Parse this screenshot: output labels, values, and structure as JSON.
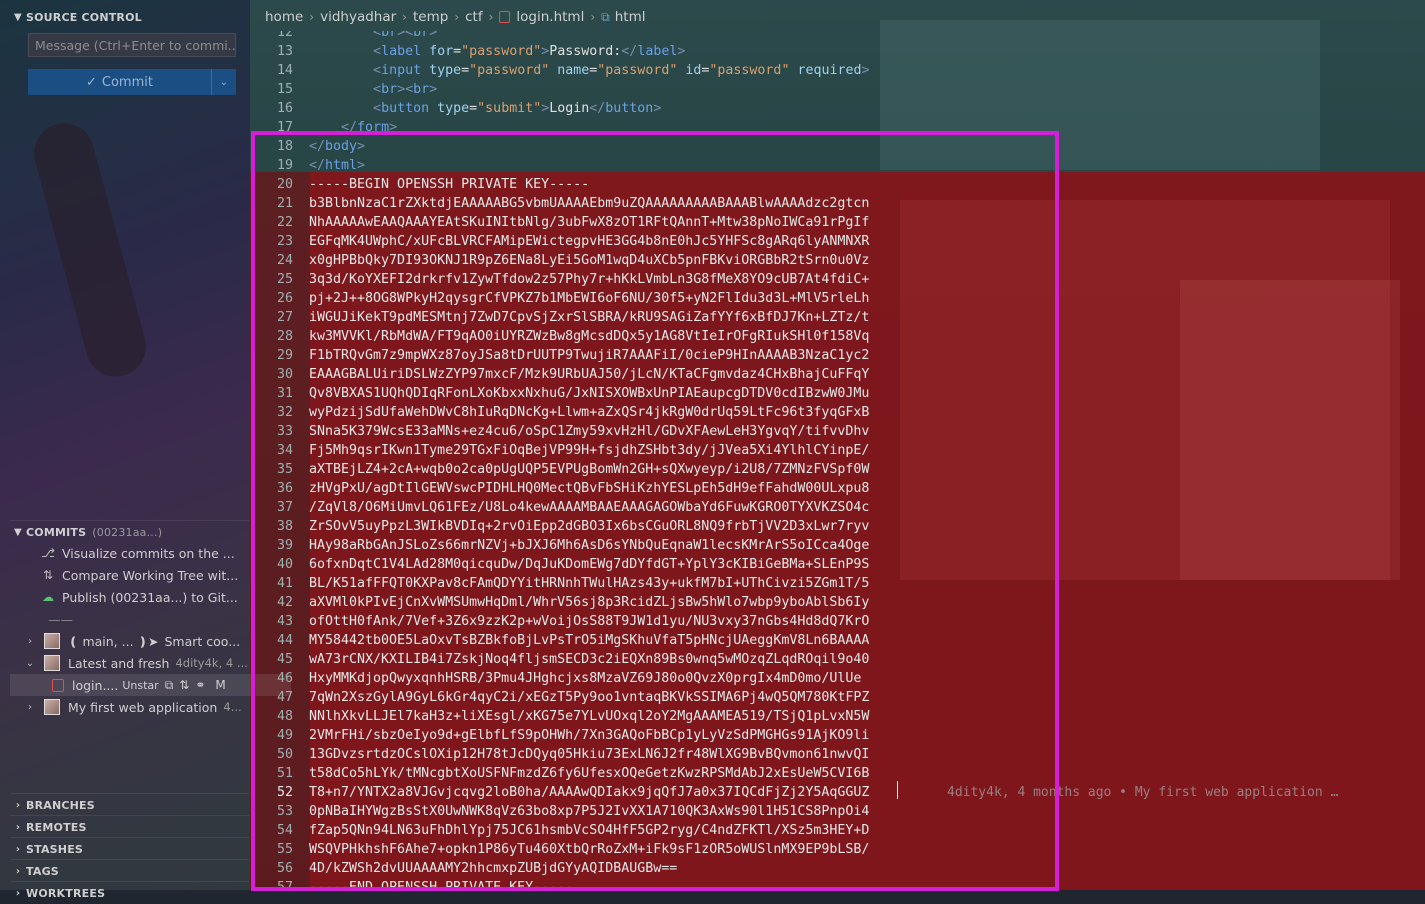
{
  "sidebar": {
    "source_control_title": "SOURCE CONTROL",
    "message_placeholder": "Message (Ctrl+Enter to commi...",
    "commit_label": "Commit",
    "commits": {
      "title": "COMMITS",
      "hash": "(00231aa...)",
      "actions": [
        {
          "label": "Visualize commits on the ...",
          "icon": "graph-icon"
        },
        {
          "label": "Compare Working Tree wit...",
          "icon": "compare-icon"
        },
        {
          "label": "Publish (00231aa...) to Git...",
          "icon": "cloud-upload-icon"
        }
      ],
      "separator": "——",
      "items": [
        {
          "branch": "❪ main, ... ❫➤",
          "message": "Smart coo...",
          "expanded": false
        },
        {
          "message": "Latest and fresh",
          "meta": "4dity4k, 4 ...",
          "expanded": true
        },
        {
          "message": "My first web application",
          "meta": "4...",
          "expanded": false
        }
      ],
      "file": {
        "name": "login....",
        "state": "Unstar",
        "status": "M"
      }
    },
    "sections": [
      "BRANCHES",
      "REMOTES",
      "STASHES",
      "TAGS",
      "WORKTREES"
    ]
  },
  "breadcrumb": [
    "home",
    "vidhyadhar",
    "temp",
    "ctf",
    "login.html",
    "html"
  ],
  "editor": {
    "lines": [
      {
        "n": "12",
        "indent": "        ",
        "parts": [
          [
            "tag",
            "<"
          ],
          [
            "tagname",
            "br"
          ],
          [
            "tag",
            "><"
          ],
          [
            "tagname",
            "br"
          ],
          [
            "tag",
            ">"
          ]
        ]
      },
      {
        "n": "13",
        "indent": "        ",
        "parts": [
          [
            "tag",
            "<"
          ],
          [
            "tagname",
            "label"
          ],
          [
            "plain",
            " "
          ],
          [
            "attr",
            "for"
          ],
          [
            "plain",
            "="
          ],
          [
            "val",
            "\"password\""
          ],
          [
            "tag",
            ">"
          ],
          [
            "plain",
            "Password:"
          ],
          [
            "tag",
            "</"
          ],
          [
            "tagname",
            "label"
          ],
          [
            "tag",
            ">"
          ]
        ]
      },
      {
        "n": "14",
        "indent": "        ",
        "parts": [
          [
            "tag",
            "<"
          ],
          [
            "tagname",
            "input"
          ],
          [
            "plain",
            " "
          ],
          [
            "attr",
            "type"
          ],
          [
            "plain",
            "="
          ],
          [
            "val",
            "\"password\""
          ],
          [
            "plain",
            " "
          ],
          [
            "attr",
            "name"
          ],
          [
            "plain",
            "="
          ],
          [
            "val",
            "\"password\""
          ],
          [
            "plain",
            " "
          ],
          [
            "attr",
            "id"
          ],
          [
            "plain",
            "="
          ],
          [
            "val",
            "\"password\""
          ],
          [
            "plain",
            " "
          ],
          [
            "attr",
            "required"
          ],
          [
            "tag",
            ">"
          ]
        ]
      },
      {
        "n": "15",
        "indent": "        ",
        "parts": [
          [
            "tag",
            "<"
          ],
          [
            "tagname",
            "br"
          ],
          [
            "tag",
            "><"
          ],
          [
            "tagname",
            "br"
          ],
          [
            "tag",
            ">"
          ]
        ]
      },
      {
        "n": "16",
        "indent": "        ",
        "parts": [
          [
            "tag",
            "<"
          ],
          [
            "tagname",
            "button"
          ],
          [
            "plain",
            " "
          ],
          [
            "attr",
            "type"
          ],
          [
            "plain",
            "="
          ],
          [
            "val",
            "\"submit\""
          ],
          [
            "tag",
            ">"
          ],
          [
            "plain",
            "Login"
          ],
          [
            "tag",
            "</"
          ],
          [
            "tagname",
            "button"
          ],
          [
            "tag",
            ">"
          ]
        ]
      },
      {
        "n": "17",
        "indent": "    ",
        "parts": [
          [
            "tag",
            "</"
          ],
          [
            "tagname",
            "form"
          ],
          [
            "tag",
            ">"
          ]
        ]
      },
      {
        "n": "18",
        "indent": "",
        "parts": [
          [
            "tag",
            "</"
          ],
          [
            "tagname",
            "body"
          ],
          [
            "tag",
            ">"
          ]
        ]
      },
      {
        "n": "19",
        "indent": "",
        "parts": [
          [
            "tag",
            "</"
          ],
          [
            "tagname",
            "html"
          ],
          [
            "tag",
            ">"
          ]
        ]
      },
      {
        "n": "20",
        "indent": "",
        "parts": [
          [
            "key",
            "-----BEGIN OPENSSH PRIVATE KEY-----"
          ]
        ]
      },
      {
        "n": "21",
        "indent": "",
        "parts": [
          [
            "key",
            "b3BlbnNzaC1rZXktdjEAAAAABG5vbmUAAAAEbm9uZQAAAAAAAAABAAABlwAAAAdzc2gtcn"
          ]
        ]
      },
      {
        "n": "22",
        "indent": "",
        "parts": [
          [
            "key",
            "NhAAAAAwEAAQAAAYEAtSKuINItbNlg/3ubFwX8zOT1RFtQAnnT+Mtw38pNoIWCa91rPgIf"
          ]
        ]
      },
      {
        "n": "23",
        "indent": "",
        "parts": [
          [
            "key",
            "EGFqMK4UWphC/xUFcBLVRCFAMipEWictegpvHE3GG4b8nE0hJc5YHFSc8gARq6lyANMNXR"
          ]
        ]
      },
      {
        "n": "24",
        "indent": "",
        "parts": [
          [
            "key",
            "x0gHPBbQky7DI93OKNJ1R9pZ6ENa8LyEi5GoM1wqD4uXCb5pnFBKviORGBbR2tSrn0u0Vz"
          ]
        ]
      },
      {
        "n": "25",
        "indent": "",
        "parts": [
          [
            "key",
            "3q3d/KoYXEFI2drkrfv1ZywTfdow2z57Phy7r+hKkLVmbLn3G8fMeX8YO9cUB7At4fdiC+"
          ]
        ]
      },
      {
        "n": "26",
        "indent": "",
        "parts": [
          [
            "key",
            "pj+2J++8OG8WPkyH2qysgrCfVPKZ7b1MbEWI6oF6NU/30f5+yN2FlIdu3d3L+MlV5rleLh"
          ]
        ]
      },
      {
        "n": "27",
        "indent": "",
        "parts": [
          [
            "key",
            "iWGUJiKekT9pdMESMtnj7ZwD7CpvSjZxrSlSBRA/kRU9SAGiZafYYf6xBfDJ7Kn+LZTz/t"
          ]
        ]
      },
      {
        "n": "28",
        "indent": "",
        "parts": [
          [
            "key",
            "kw3MVVKl/RbMdWA/FT9qAO0iUYRZWzBw8gMcsdDQx5y1AG8VtIeIrOFgRIukSHl0f158Vq"
          ]
        ]
      },
      {
        "n": "29",
        "indent": "",
        "parts": [
          [
            "key",
            "F1bTRQvGm7z9mpWXz87oyJSa8tDrUUTP9TwujiR7AAAFiI/0cieP9HInAAAAB3NzaC1yc2"
          ]
        ]
      },
      {
        "n": "30",
        "indent": "",
        "parts": [
          [
            "key",
            "EAAAGBALUiriDSLWzZYP97mxcF/Mzk9URbUAJ50/jLcN/KTaCFgmvdaz4CHxBhajCuFFqY"
          ]
        ]
      },
      {
        "n": "31",
        "indent": "",
        "parts": [
          [
            "key",
            "Qv8VBXAS1UQhQDIqRFonLXoKbxxNxhuG/JxNISXOWBxUnPIAEaupcgDTDV0cdIBzwW0JMu"
          ]
        ]
      },
      {
        "n": "32",
        "indent": "",
        "parts": [
          [
            "key",
            "wyPdzijSdUfaWehDWvC8hIuRqDNcKg+Llwm+aZxQSr4jkRgW0drUq59LtFc96t3fyqGFxB"
          ]
        ]
      },
      {
        "n": "33",
        "indent": "",
        "parts": [
          [
            "key",
            "SNna5K379WcsE33aMNs+ez4cu6/oSpC1Zmy59xvHzHl/GDvXFAewLeH3YgvqY/tifvvDhv"
          ]
        ]
      },
      {
        "n": "34",
        "indent": "",
        "parts": [
          [
            "key",
            "Fj5Mh9qsrIKwn1Tyme29TGxFiOqBejVP99H+fsjdhZSHbt3dy/jJVea5Xi4YlhlCYinpE/"
          ]
        ]
      },
      {
        "n": "35",
        "indent": "",
        "parts": [
          [
            "key",
            "aXTBEjLZ4+2cA+wqb0o2ca0pUgUQP5EVPUgBomWn2GH+sQXwyeyp/i2U8/7ZMNzFVSpf0W"
          ]
        ]
      },
      {
        "n": "36",
        "indent": "",
        "parts": [
          [
            "key",
            "zHVgPxU/agDtIlGEWVswcPIDHLHQ0MectQBvFbSHiKzhYESLpEh5dH9efFahdW00ULxpu8"
          ]
        ]
      },
      {
        "n": "37",
        "indent": "",
        "parts": [
          [
            "key",
            "/ZqVl8/O6MiUmvLQ61FEz/U8Lo4kewAAAAMBAAEAAAGAGOWbaYd6FuwKGRO0TYXVKZSO4c"
          ]
        ]
      },
      {
        "n": "38",
        "indent": "",
        "parts": [
          [
            "key",
            "ZrSOvV5uyPpzL3WIkBVDIq+2rvOiEpp2dGBO3Ix6bsCGuORL8NQ9frbTjVV2D3xLwr7ryv"
          ]
        ]
      },
      {
        "n": "39",
        "indent": "",
        "parts": [
          [
            "key",
            "HAy98aRbGAnJSLoZs66mrNZVj+bJXJ6Mh6AsD6sYNbQuEqnaW1lecsKMrArS5oICca4Oge"
          ]
        ]
      },
      {
        "n": "40",
        "indent": "",
        "parts": [
          [
            "key",
            "6ofxnDqtC1V4LAd28M0qicquDw/DqJuKDomEWg7dDYfdGT+YplY3cKIBiGeBMa+SLEnP9S"
          ]
        ]
      },
      {
        "n": "41",
        "indent": "",
        "parts": [
          [
            "key",
            "BL/K51afFFQT0KXPav8cFAmQDYYitHRNnhTWulHAzs43y+ukfM7bI+UThCivzi5ZGm1T/5"
          ]
        ]
      },
      {
        "n": "42",
        "indent": "",
        "parts": [
          [
            "key",
            "aXVMl0kPIvEjCnXvWMSUmwHqDml/WhrV56sj8p3RcidZLjsBw5hWlo7wbp9yboAblSb6Iy"
          ]
        ]
      },
      {
        "n": "43",
        "indent": "",
        "parts": [
          [
            "key",
            "ofOttH0fAnk/7Vef+3Z6x9zzK2p+wVoijOsS88T9JW1d1yu/NU3vxy37nGbs4Hd8dQ7KrO"
          ]
        ]
      },
      {
        "n": "44",
        "indent": "",
        "parts": [
          [
            "key",
            "MY58442tb0OE5LaOxvTsBZBkfoBjLvPsTrO5iMgSKhuVfaT5pHNcjUAeggKmV8Ln6BAAAA"
          ]
        ]
      },
      {
        "n": "45",
        "indent": "",
        "parts": [
          [
            "key",
            "wA73rCNX/KXILIB4i7ZskjNoq4fljsmSECD3c2iEQXn89Bs0wnq5wMOzqZLqdROqil9o40"
          ]
        ]
      },
      {
        "n": "46",
        "indent": "",
        "parts": [
          [
            "key",
            "HxyMMKdjopQwyxqnhHSRB/3Pmu4JHghcjxs8MzaVZ69J80o0QvzX0prgIx4mD0mo/UlUe"
          ]
        ]
      },
      {
        "n": "47",
        "indent": "",
        "parts": [
          [
            "key",
            "7qWn2XszGylA9GyL6kGr4qyC2i/xEGzT5Py9oo1vntaqBKVkSSIMA6Pj4wQ5QM780KtFPZ"
          ]
        ]
      },
      {
        "n": "48",
        "indent": "",
        "parts": [
          [
            "key",
            "NNlhXkvLLJEl7kaH3z+liXEsgl/xKG75e7YLvUOxql2oY2MgAAAMEA519/TSjQ1pLvxN5W"
          ]
        ]
      },
      {
        "n": "49",
        "indent": "",
        "parts": [
          [
            "key",
            "2VMrFHi/sbzOeIyo9d+gElbfLfS9pOHWh/7Xn3GAQoFbBCp1yLyVzSdPMGHGs91AjKO9li"
          ]
        ]
      },
      {
        "n": "50",
        "indent": "",
        "parts": [
          [
            "key",
            "13GDvzsrtdzOCslOXip12H78tJcDQyq05Hkiu73ExLN6J2fr48WlXG9BvBQvmon61nwvQI"
          ]
        ]
      },
      {
        "n": "51",
        "indent": "",
        "parts": [
          [
            "key",
            "t58dCo5hLYk/tMNcgbtXoUSFNFmzdZ6fy6UfesxOQeGetzKwzRPSMdAbJ2xEsUeW5CVI6B"
          ]
        ]
      },
      {
        "n": "52",
        "indent": "",
        "parts": [
          [
            "key",
            "T8+n7/YNTX2a8VJGvjcqvg2loB0ha/AAAAwQDIakx9jqQfJ7a0x37IQCdFjZj2Y5AqGGUZ"
          ]
        ],
        "active": true
      },
      {
        "n": "53",
        "indent": "",
        "parts": [
          [
            "key",
            "0pNBaIHYWgzBsStX0UwNWK8qVz63bo8xp7P5J2IvXX1A710QK3AxWs90l1H51CS8PnpOi4"
          ]
        ]
      },
      {
        "n": "54",
        "indent": "",
        "parts": [
          [
            "key",
            "fZap5QNn94LN63uFhDhlYpj75JC61hsmbVcSO4HfF5GP2ryg/C4ndZFKTl/XSz5m3HEY+D"
          ]
        ]
      },
      {
        "n": "55",
        "indent": "",
        "parts": [
          [
            "key",
            "WSQVPHkhshF6Ahe7+opkn1P86yTu460XtbQrRoZxM+iFk9sF1zOR5oWUSlnMX9EP9bLSB/"
          ]
        ]
      },
      {
        "n": "56",
        "indent": "",
        "parts": [
          [
            "key",
            "4D/kZWSh2dvUUAAAAMY2hhcmxpZUBjdGYyAQIDBAUGBw=="
          ]
        ]
      },
      {
        "n": "57",
        "indent": "",
        "parts": [
          [
            "key",
            "-----END OPENSSH PRIVATE KEY-----"
          ]
        ]
      }
    ],
    "blame": "4dity4k, 4 months ago • My first web application …"
  },
  "colors": {
    "highlight_box": "#d41ed8",
    "commit_button": "#1b4f84",
    "red_overlay": "#960c12"
  }
}
